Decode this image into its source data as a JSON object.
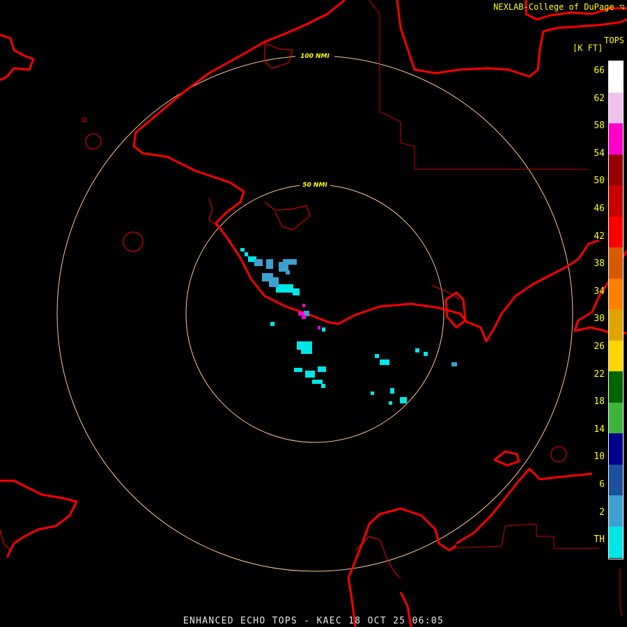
{
  "header": {
    "credit": "NEXLAB-College of DuPage ◹"
  },
  "legend": {
    "title": "TOPS",
    "unit": "[K FT]",
    "labels": [
      "66",
      "62",
      "58",
      "54",
      "50",
      "46",
      "42",
      "38",
      "34",
      "30",
      "26",
      "22",
      "18",
      "14",
      "10",
      "6",
      "2",
      "TH"
    ],
    "colors": [
      "#ffffff",
      "#f2c0ec",
      "#ff00cc",
      "#960000",
      "#c80000",
      "#ff0000",
      "#d85a00",
      "#ff8000",
      "#e0a400",
      "#ffd700",
      "#006400",
      "#3cb43c",
      "#00008c",
      "#1e50a0",
      "#3ca0d0",
      "#00e6e6"
    ]
  },
  "range_rings": [
    {
      "label": "100 NMI",
      "radius_nmi": 100
    },
    {
      "label": "50 NMI",
      "radius_nmi": 50
    }
  ],
  "footer": {
    "title": "ENHANCED ECHO TOPS - KAEC 18 OCT 25 06:05"
  },
  "colors": {
    "coastline": "#ff0000",
    "ring": "#ffc896",
    "ring_label": "#ffff00",
    "background": "#000000"
  }
}
